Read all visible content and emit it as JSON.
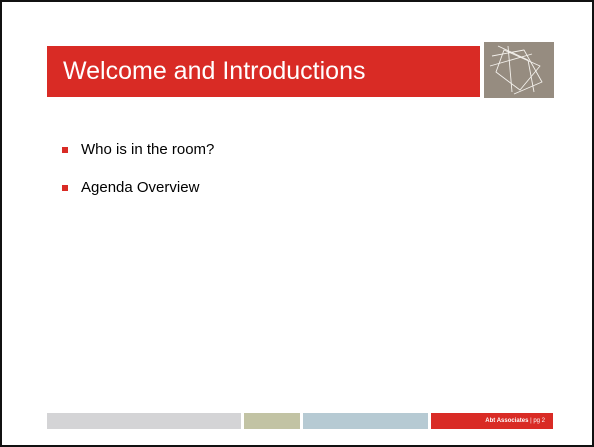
{
  "slide": {
    "title": "Welcome and Introductions",
    "bullets": [
      "Who is in the room?",
      "Agenda Overview"
    ]
  },
  "footer": {
    "organization": "Abt Associates",
    "separator": " | ",
    "page": "pg 2"
  },
  "colors": {
    "accent": "#d92b25",
    "logo_bg": "#968c80",
    "footer_gray": "#d4d4d6",
    "footer_olive": "#c2c3a4",
    "footer_blue": "#b6cad3"
  },
  "icons": {
    "logo": "abstract-star-logo-icon",
    "bullet": "square-bullet-icon"
  }
}
